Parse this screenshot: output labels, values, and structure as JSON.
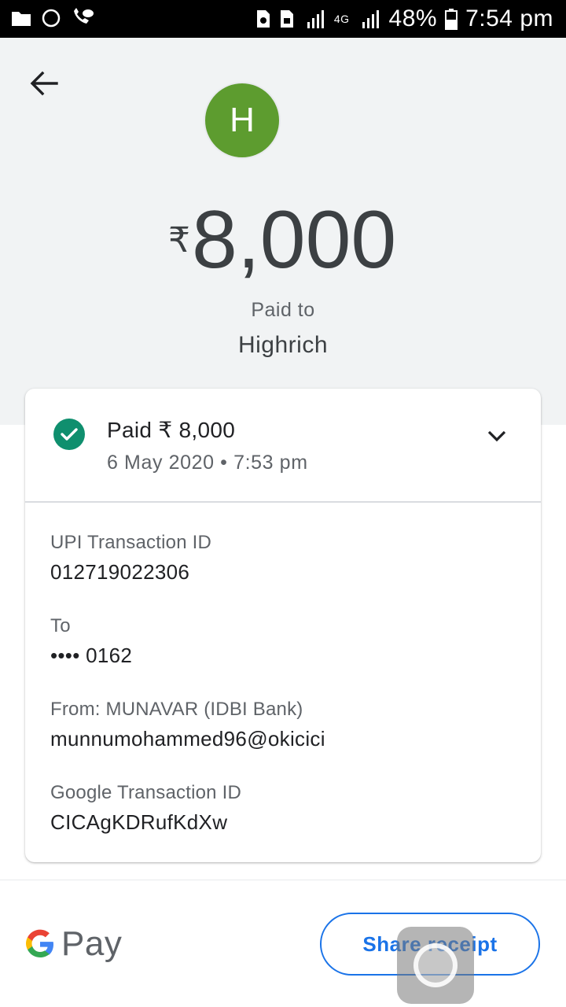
{
  "status_bar": {
    "battery": "48%",
    "time": "7:54 pm",
    "network": "4G"
  },
  "header": {
    "avatar_letter": "H",
    "currency_symbol": "₹",
    "amount": "8,000",
    "paid_to_label": "Paid to",
    "payee_name": "Highrich"
  },
  "summary": {
    "paid_text": "Paid ₹ 8,000",
    "date_time": "6 May 2020 • 7:53 pm"
  },
  "details": {
    "upi_label": "UPI Transaction ID",
    "upi_value": "012719022306",
    "to_label": "To",
    "to_value": "•••• 0162",
    "from_label": "From: MUNAVAR (IDBI Bank)",
    "from_value": "munnumohammed96@okicici",
    "google_label": "Google Transaction ID",
    "google_value": "CICAgKDRufKdXw"
  },
  "footer": {
    "brand_text": "Pay",
    "share_label": "Share receipt"
  },
  "colors": {
    "accent": "#1a73e8",
    "success": "#0f8f6e",
    "avatar": "#5d9c2f"
  }
}
